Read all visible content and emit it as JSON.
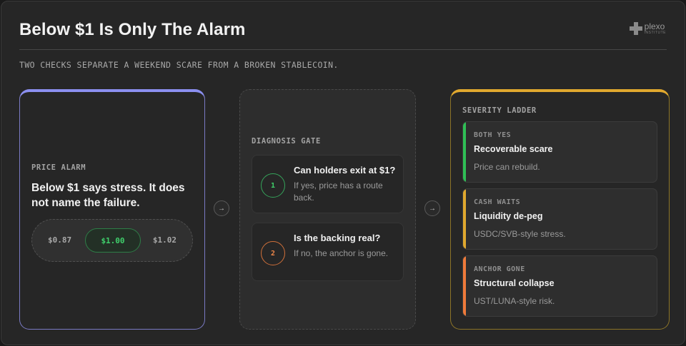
{
  "header": {
    "title": "Below $1 Is Only The Alarm",
    "subtitle": "TWO CHECKS SEPARATE A WEEKEND SCARE FROM A BROKEN STABLECOIN.",
    "logo": {
      "name": "plexo",
      "subname": "INSTITUTE",
      "icon": "plus-cross-icon"
    }
  },
  "alarm": {
    "label": "PRICE ALARM",
    "text": "Below $1 says stress. It does not name the failure.",
    "prices": {
      "low": "$0.87",
      "peg": "$1.00",
      "high": "$1.02"
    },
    "accent": "#8b8ff0"
  },
  "arrows": {
    "glyph": "→"
  },
  "gate": {
    "label": "DIAGNOSIS GATE",
    "questions": [
      {
        "num": "1",
        "title": "Can holders exit at $1?",
        "sub": "If yes, price has a route back.",
        "color": "#3fcf6b"
      },
      {
        "num": "2",
        "title": "Is the backing real?",
        "sub": "If no, the anchor is gone.",
        "color": "#f0874a"
      }
    ]
  },
  "ladder": {
    "label": "SEVERITY LADDER",
    "accent": "#e0a82e",
    "steps": [
      {
        "tag": "BOTH YES",
        "title": "Recoverable scare",
        "desc": "Price can rebuild.",
        "color": "#2fbf55"
      },
      {
        "tag": "CASH WAITS",
        "title": "Liquidity de-peg",
        "desc": "USDC/SVB-style stress.",
        "color": "#e0a82e"
      },
      {
        "tag": "ANCHOR GONE",
        "title": "Structural collapse",
        "desc": "UST/LUNA-style risk.",
        "color": "#ef7a3a"
      }
    ]
  }
}
